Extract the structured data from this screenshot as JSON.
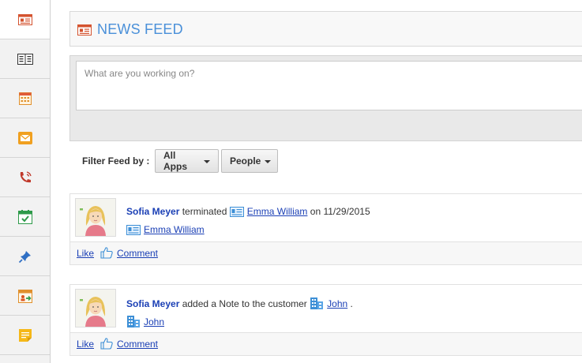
{
  "sidebar": {
    "items": [
      {
        "icon": "news-feed-icon",
        "active": true
      },
      {
        "icon": "contacts-icon",
        "active": false
      },
      {
        "icon": "calendar-icon",
        "active": false
      },
      {
        "icon": "mail-icon",
        "active": false
      },
      {
        "icon": "phone-icon",
        "active": false
      },
      {
        "icon": "task-check-icon",
        "active": false
      },
      {
        "icon": "pin-icon",
        "active": false
      },
      {
        "icon": "share-calendar-icon",
        "active": false
      },
      {
        "icon": "notes-icon",
        "active": false
      }
    ]
  },
  "header": {
    "title": "NEWS FEED",
    "icon": "news-feed-icon"
  },
  "status": {
    "placeholder": "What are you working on?"
  },
  "filter": {
    "label": "Filter Feed by :",
    "apps_button": "All Apps",
    "people_button": "People"
  },
  "feed": [
    {
      "user": "Sofia Meyer",
      "action": "terminated",
      "target_icon": "employee-card-icon",
      "target": "Emma William",
      "suffix": "on 11/29/2015",
      "related_icon": "employee-card-icon",
      "related": "Emma William",
      "like": "Like",
      "comment": "Comment"
    },
    {
      "user": "Sofia Meyer",
      "action": "added a Note to the customer",
      "target_icon": "building-icon",
      "target": "John",
      "suffix": ".",
      "related_icon": "building-icon",
      "related": "John",
      "like": "Like",
      "comment": "Comment"
    }
  ],
  "colors": {
    "accent": "#4a90d9",
    "link": "#1a3fb5",
    "username": "#1d3f8f",
    "sidebar_bg": "#f2f2f2"
  }
}
